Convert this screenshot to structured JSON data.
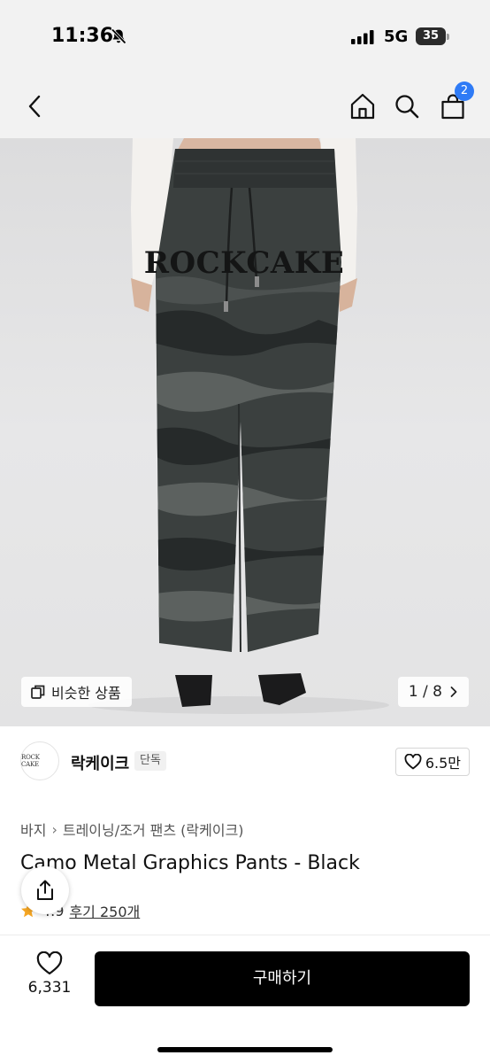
{
  "status_bar": {
    "time": "11:36",
    "network": "5G",
    "battery": "35"
  },
  "header": {
    "cart_count": "2",
    "icons": [
      "back-icon",
      "home-icon",
      "search-icon",
      "cart-icon"
    ]
  },
  "product_image": {
    "similar_label": "비슷한 상품",
    "page_indicator": "1 / 8",
    "wordmark": "ROCKCAKE",
    "colors": {
      "background": "#e6e6e7",
      "pants_base": "#3b403f",
      "camo_dark": "#262a2a",
      "camo_light": "#5c615f"
    }
  },
  "brand": {
    "logo_text": "ROCK CAKE",
    "name": "락케이크",
    "badge": "단독",
    "likes": "6.5만"
  },
  "breadcrumb": [
    "바지",
    "트레이닝/조거 팬츠 (락케이크)"
  ],
  "product": {
    "title": "Camo Metal Graphics Pants - Black",
    "rating": "4.9",
    "review_link": "후기 250개"
  },
  "bottom_bar": {
    "wish_count": "6,331",
    "buy_label": "구매하기"
  },
  "colors": {
    "accent": "#2f7bf6",
    "buy_button": "#000000",
    "star": "#f5a623"
  }
}
